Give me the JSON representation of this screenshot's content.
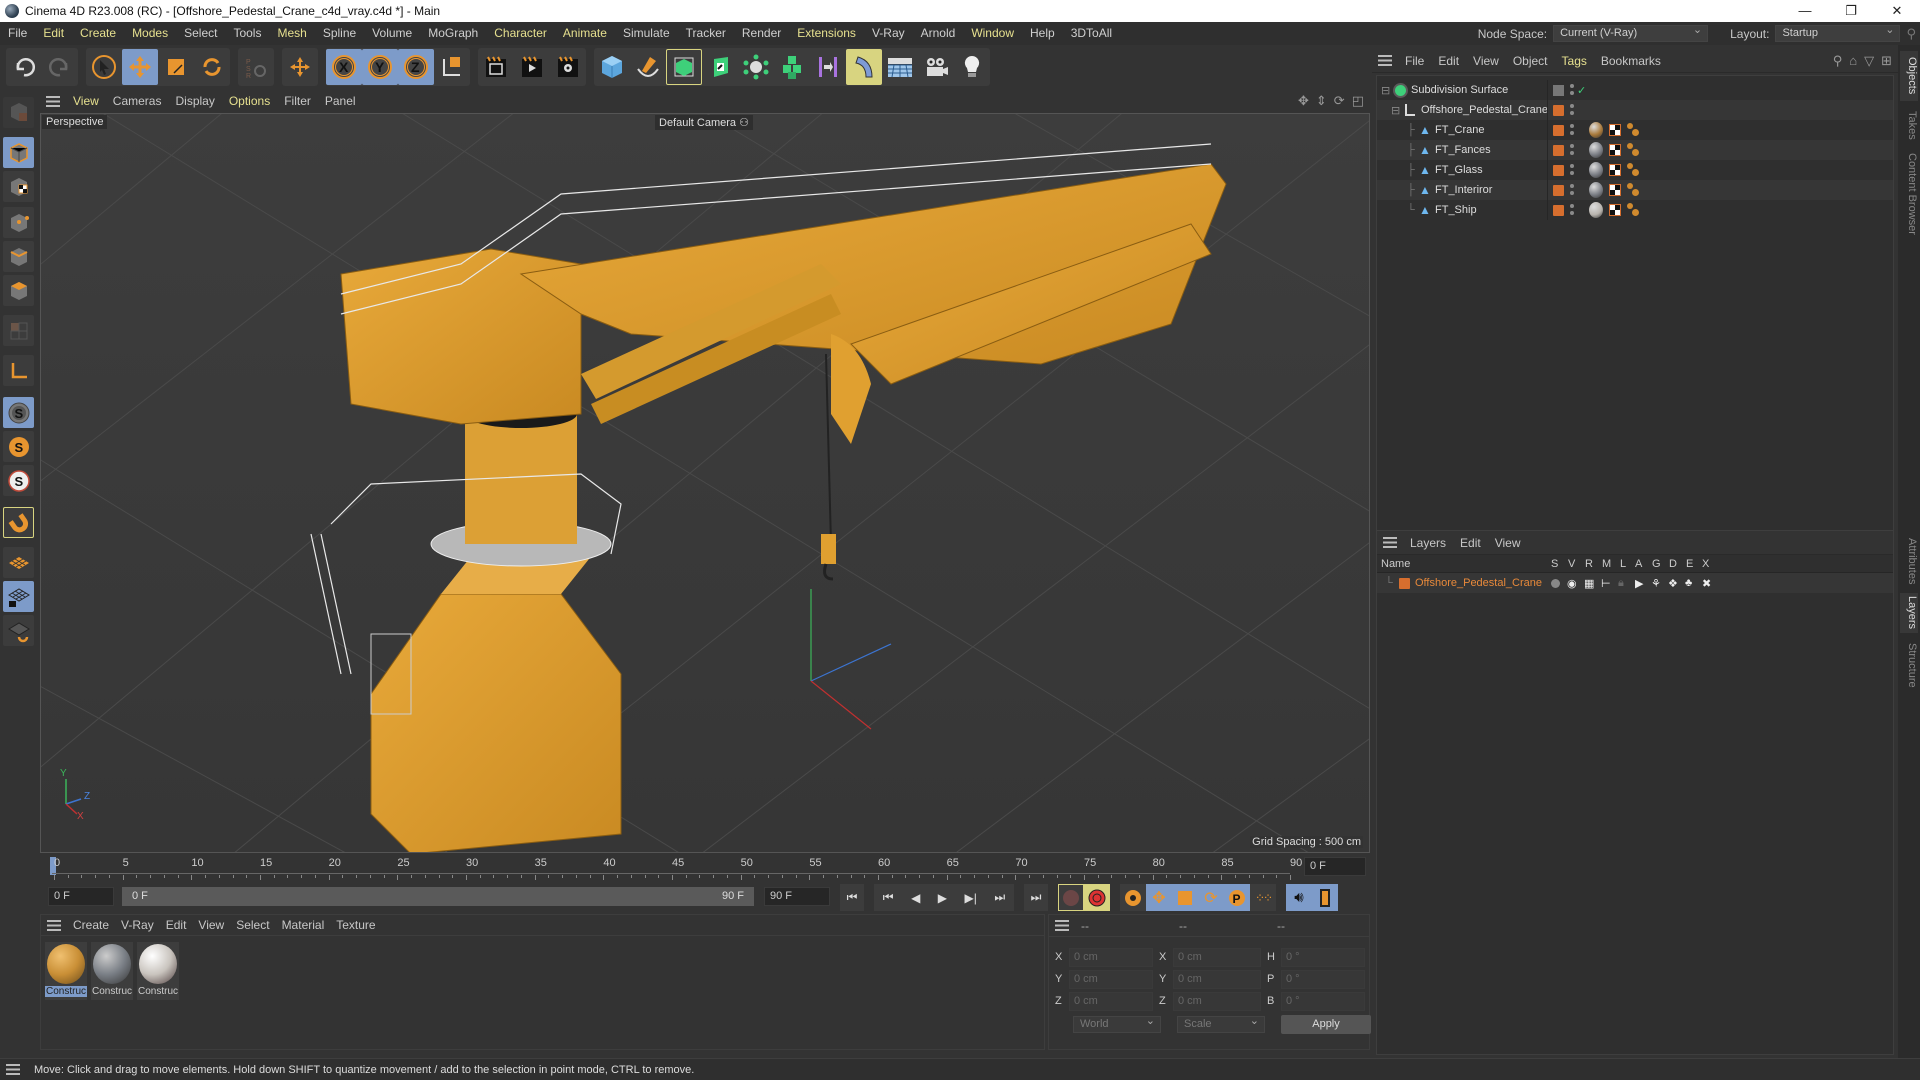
{
  "window": {
    "title": "Cinema 4D R23.008 (RC) - [Offshore_Pedestal_Crane_c4d_vray.c4d *] - Main",
    "controls": [
      "minimize",
      "restore",
      "close"
    ]
  },
  "menubar": {
    "items": [
      "File",
      "Edit",
      "Create",
      "Modes",
      "Select",
      "Tools",
      "Mesh",
      "Spline",
      "Volume",
      "MoGraph",
      "Character",
      "Animate",
      "Simulate",
      "Tracker",
      "Render",
      "Extensions",
      "V-Ray",
      "Arnold",
      "Window",
      "Help",
      "3DToAll"
    ],
    "node_space_label": "Node Space:",
    "node_space_value": "Current (V-Ray)",
    "layout_label": "Layout:",
    "layout_value": "Startup"
  },
  "toolbar": {
    "groups": [
      [
        "undo-icon",
        "redo-icon"
      ],
      [
        "select-arrow-icon",
        "move-icon",
        "scale-icon",
        "rotate-icon"
      ],
      [
        "psr-icon"
      ],
      [
        "transform-icon"
      ],
      [
        "x-axis-icon",
        "y-axis-icon",
        "z-axis-icon",
        "coordinate-system-icon"
      ],
      [
        "render-view-icon",
        "render-picture-viewer-icon",
        "render-settings-icon"
      ],
      [
        "cube-icon",
        "pen-icon",
        "subdivision-icon",
        "extrude-icon",
        "cloner-icon",
        "array-icon",
        "symmetry-icon",
        "deformer-icon",
        "floor-icon",
        "camera-icon",
        "light-icon"
      ]
    ]
  },
  "left_toolbar": [
    "make-editable-icon",
    "model-mode-icon",
    "texture-mode-icon",
    "points-mode-icon",
    "edges-mode-icon",
    "polygons-mode-icon",
    "uv-mode-icon",
    "axis-icon",
    "snap-s-icon",
    "snap-s-orange-icon",
    "snap-s-red-icon",
    "magnet-icon",
    "workplane-icon",
    "locked-workplane-icon",
    "workplane-rotate-icon"
  ],
  "viewport": {
    "menu": [
      "View",
      "Cameras",
      "Display",
      "Options",
      "Filter",
      "Panel"
    ],
    "projection": "Perspective",
    "camera": "Default Camera",
    "grid_spacing": "Grid Spacing : 500 cm",
    "axis_labels": {
      "x": "X",
      "y": "Y",
      "z": "Z"
    }
  },
  "timeline": {
    "ticks": [
      "0",
      "5",
      "10",
      "15",
      "20",
      "25",
      "30",
      "35",
      "40",
      "45",
      "50",
      "55",
      "60",
      "65",
      "70",
      "75",
      "80",
      "85",
      "90"
    ],
    "current_frame": "0 F",
    "start_frame": "0 F",
    "range_start": "0 F",
    "range_end": "90 F",
    "end_frame": "90 F"
  },
  "materials": {
    "menu": [
      "Create",
      "V-Ray",
      "Edit",
      "View",
      "Select",
      "Material",
      "Texture"
    ],
    "items": [
      {
        "name": "Construc",
        "selected": true,
        "color": "#c98f36"
      },
      {
        "name": "Construc",
        "selected": false,
        "color": "#7a7f86"
      },
      {
        "name": "Construc",
        "selected": false,
        "color": "#c9c4be"
      }
    ]
  },
  "coordinates": {
    "headers": [
      "--",
      "--",
      "--"
    ],
    "rows": [
      {
        "l1": "X",
        "v1": "0 cm",
        "l2": "X",
        "v2": "0 cm",
        "l3": "H",
        "v3": "0 °"
      },
      {
        "l1": "Y",
        "v1": "0 cm",
        "l2": "Y",
        "v2": "0 cm",
        "l3": "P",
        "v3": "0 °"
      },
      {
        "l1": "Z",
        "v1": "0 cm",
        "l2": "Z",
        "v2": "0 cm",
        "l3": "B",
        "v3": "0 °"
      }
    ],
    "space": "World",
    "mode": "Scale",
    "apply_label": "Apply"
  },
  "objects_panel": {
    "menu": [
      "File",
      "Edit",
      "View",
      "Object",
      "Tags",
      "Bookmarks"
    ],
    "objects": [
      {
        "name": "Subdivision Surface",
        "level": 0,
        "type": "subdivision"
      },
      {
        "name": "Offshore_Pedestal_Crane",
        "level": 1,
        "type": "null"
      },
      {
        "name": "FT_Crane",
        "level": 2,
        "type": "polygon"
      },
      {
        "name": "FT_Fances",
        "level": 2,
        "type": "polygon"
      },
      {
        "name": "FT_Glass",
        "level": 2,
        "type": "polygon"
      },
      {
        "name": "FT_Interiror",
        "level": 2,
        "type": "polygon"
      },
      {
        "name": "FT_Ship",
        "level": 2,
        "type": "polygon"
      }
    ]
  },
  "layers_panel": {
    "menu": [
      "Layers",
      "Edit",
      "View"
    ],
    "columns": [
      "Name",
      "S",
      "V",
      "R",
      "M",
      "L",
      "A",
      "G",
      "D",
      "E",
      "X"
    ],
    "layers": [
      {
        "name": "Offshore_Pedestal_Crane",
        "color": "#d66e2e"
      }
    ]
  },
  "side_tabs": {
    "top": [
      "Objects",
      "Takes",
      "Content Browser"
    ],
    "bottom": [
      "Attributes",
      "Layers",
      "Structure"
    ]
  },
  "status": "Move: Click and drag to move elements. Hold down SHIFT to quantize movement / add to the selection in point mode, CTRL to remove.",
  "colors": {
    "accent_select": "#7d9bc9",
    "highlight_menu": "#e6e08f",
    "layer_orange": "#d66e2e",
    "crane_yellow": "#e0a030"
  }
}
